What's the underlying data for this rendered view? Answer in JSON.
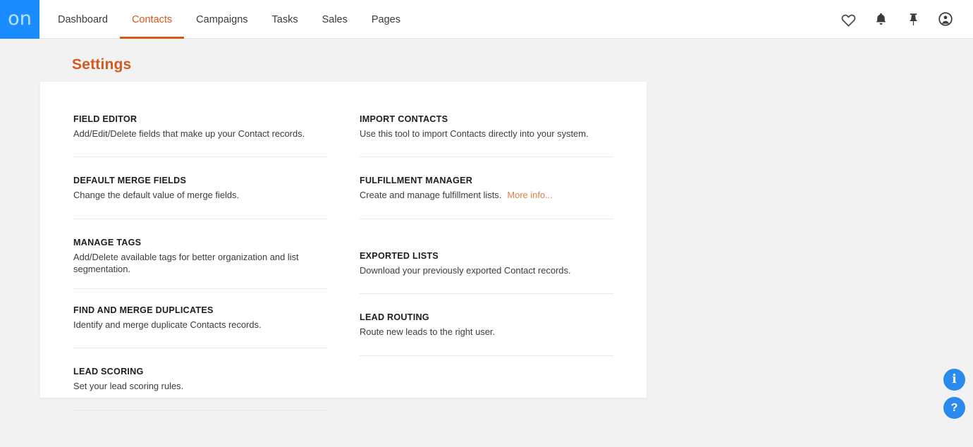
{
  "header": {
    "logo_text": "on",
    "logo_bg": "#1a8cff",
    "accent": "#d4591f",
    "nav": [
      {
        "label": "Dashboard",
        "active": false
      },
      {
        "label": "Contacts",
        "active": true
      },
      {
        "label": "Campaigns",
        "active": false
      },
      {
        "label": "Tasks",
        "active": false
      },
      {
        "label": "Sales",
        "active": false
      },
      {
        "label": "Pages",
        "active": false
      }
    ],
    "icons": [
      {
        "name": "heart-icon"
      },
      {
        "name": "bell-icon"
      },
      {
        "name": "pin-icon"
      },
      {
        "name": "account-circle-icon"
      }
    ]
  },
  "page": {
    "title": "Settings"
  },
  "settings": {
    "left_column": [
      {
        "title": "FIELD EDITOR",
        "desc": "Add/Edit/Delete fields that make up your Contact records."
      },
      {
        "title": "DEFAULT MERGE FIELDS",
        "desc": "Change the default value of merge fields."
      },
      {
        "title": "MANAGE TAGS",
        "desc": "Add/Delete available tags for better organization and list segmentation."
      },
      {
        "title": "FIND AND MERGE DUPLICATES",
        "desc": "Identify and merge duplicate Contacts records."
      },
      {
        "title": "LEAD SCORING",
        "desc": "Set your lead scoring rules."
      }
    ],
    "right_column": [
      {
        "title": "IMPORT CONTACTS",
        "desc": "Use this tool to import Contacts directly into your system."
      },
      {
        "title": "FULFILLMENT MANAGER",
        "desc": "Create and manage fulfillment lists.",
        "link": "More info..."
      },
      {
        "title": "EXPORTED LISTS",
        "desc": "Download your previously exported Contact records."
      },
      {
        "title": "LEAD ROUTING",
        "desc": "Route new leads to the right user."
      }
    ]
  },
  "fabs": [
    {
      "name": "info-fab",
      "glyph": "i"
    },
    {
      "name": "help-fab",
      "glyph": "?"
    }
  ]
}
